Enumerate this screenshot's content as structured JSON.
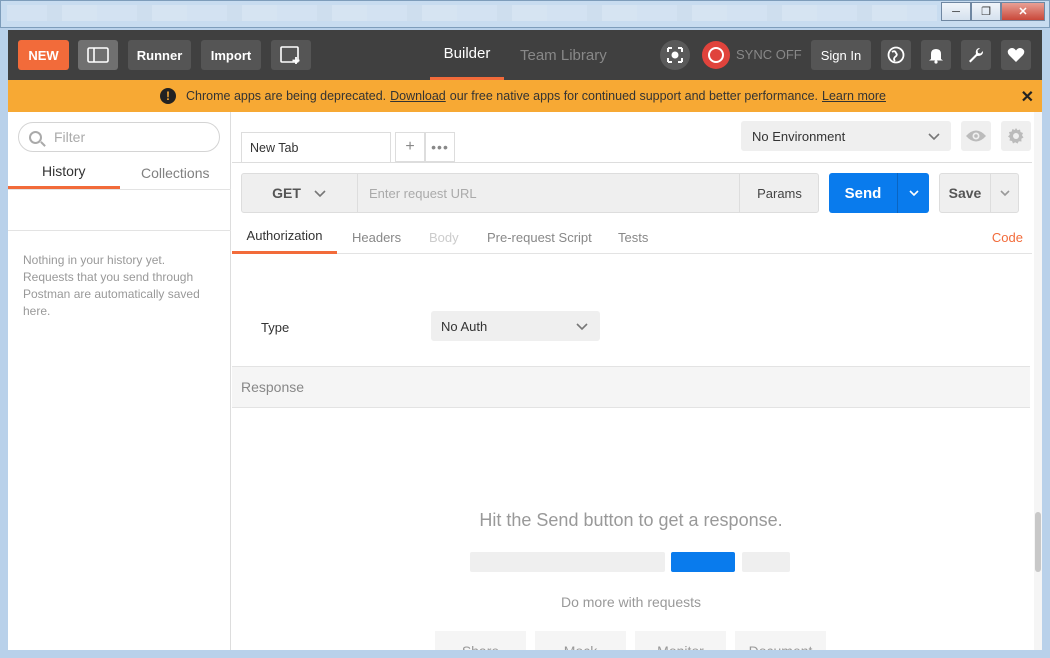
{
  "window": {
    "minimize": "─",
    "maximize": "❐",
    "close": "✕"
  },
  "toolbar": {
    "new_label": "NEW",
    "runner_label": "Runner",
    "import_label": "Import",
    "tabs": [
      {
        "label": "Builder",
        "active": true
      },
      {
        "label": "Team Library",
        "active": false
      }
    ],
    "sync_label": "SYNC OFF",
    "signin_label": "Sign In",
    "icons": [
      "layout-icon",
      "new-window-icon",
      "interceptor-icon",
      "sync-icon",
      "globe-icon",
      "bell-icon",
      "wrench-icon",
      "heart-icon"
    ],
    "colors": {
      "bar": "#404040",
      "accent": "#f26b3a",
      "sync": "#e0433c"
    }
  },
  "banner": {
    "text_before": "Chrome apps are being deprecated.",
    "link_download": "Download",
    "text_middle": "our free native apps for continued support and better performance.",
    "link_learn_more": "Learn more",
    "close": "✕",
    "color": "#f7a934"
  },
  "sidebar": {
    "filter_placeholder": "Filter",
    "tabs": [
      {
        "label": "History",
        "active": true
      },
      {
        "label": "Collections",
        "active": false
      }
    ],
    "empty_message": "Nothing in your history yet. Requests that you send through Postman are automatically saved here."
  },
  "request_tabs": {
    "tabs": [
      {
        "label": "New Tab"
      }
    ],
    "add": "+",
    "more": "•••"
  },
  "environment": {
    "selected": "No Environment"
  },
  "request": {
    "method": "GET",
    "url_placeholder": "Enter request URL",
    "url_value": "",
    "params_label": "Params",
    "send_label": "Send",
    "save_label": "Save",
    "send_color": "#097bed"
  },
  "sub_tabs": [
    {
      "label": "Authorization",
      "active": true
    },
    {
      "label": "Headers",
      "active": false
    },
    {
      "label": "Body",
      "active": false,
      "disabled": true
    },
    {
      "label": "Pre-request Script",
      "active": false
    },
    {
      "label": "Tests",
      "active": false
    }
  ],
  "code_link": "Code",
  "auth": {
    "type_label": "Type",
    "selected": "No Auth"
  },
  "response": {
    "header": "Response",
    "empty_title": "Hit the Send button to get a response.",
    "do_more": "Do more with requests",
    "actions": [
      "Share",
      "Mock",
      "Monitor",
      "Document"
    ]
  }
}
